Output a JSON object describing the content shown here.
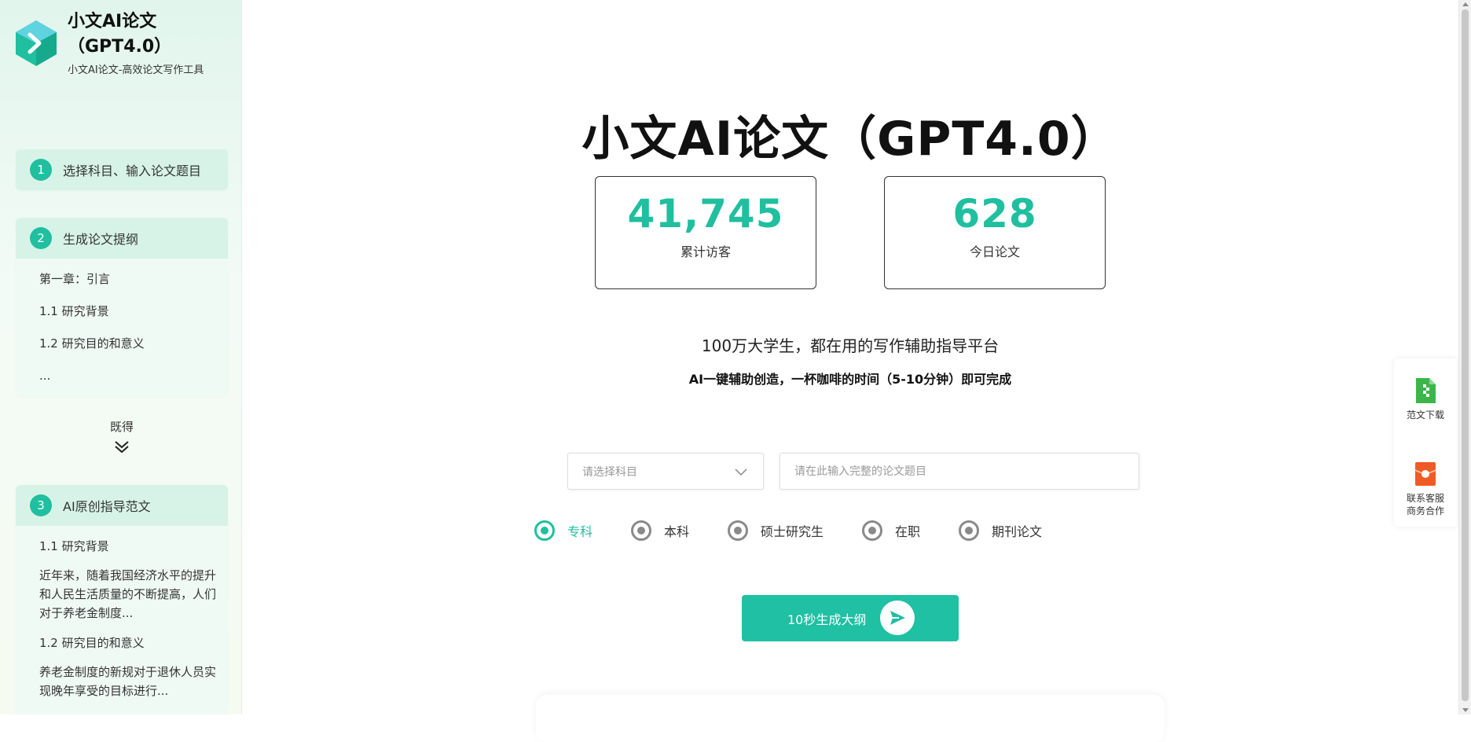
{
  "brand": {
    "title": "小文AI论文（GPT4.0）",
    "subtitle": "小文AI论文-高效论文写作工具",
    "colors": {
      "logo_primary": "#1fbf9f",
      "logo_secondary": "#6fd6e6"
    }
  },
  "sidebar": {
    "steps": [
      {
        "num": "1",
        "label": "选择科目、输入论文题目"
      },
      {
        "num": "2",
        "label": "生成论文提纲",
        "lines": [
          "第一章：引言",
          "1.1 研究背景",
          "1.2 研究目的和意义",
          "..."
        ]
      },
      {
        "num": "3",
        "label": "AI原创指导范文",
        "lines": [
          "1.1 研究背景",
          "近年来，随着我国经济水平的提升和人民生活质量的不断提高，人们对于养老金制度...",
          "1.2 研究目的和意义",
          "养老金制度的新规对于退休人员实现晚年享受的目标进行..."
        ]
      }
    ],
    "expand_label": "既得"
  },
  "hero": {
    "title": "小文AI论文（GPT4.0）",
    "stats": [
      {
        "value": "41,745",
        "label": "累计访客"
      },
      {
        "value": "628",
        "label": "今日论文"
      }
    ],
    "tagline": "100万大学生，都在用的写作辅助指导平台",
    "tagline_sub": "AI一键辅助创造，一杯咖啡的时间（5-10分钟）即可完成"
  },
  "form": {
    "subject_placeholder": "请选择科目",
    "title_placeholder": "请在此输入完整的论文题目",
    "levels": [
      {
        "label": "专科",
        "selected": true
      },
      {
        "label": "本科",
        "selected": false
      },
      {
        "label": "硕士研究生",
        "selected": false
      },
      {
        "label": "在职",
        "selected": false
      },
      {
        "label": "期刊论文",
        "selected": false
      }
    ],
    "generate_label": "10秒生成大纲"
  },
  "float_panel": {
    "download_label": "范文下载",
    "contact_line1": "联系客服",
    "contact_line2": "商务合作"
  },
  "colors": {
    "accent": "#1fbf9f",
    "sidebar_header": "#d7f3e8",
    "download_icon": "#3cb64a",
    "contact_icon": "#f05a24"
  }
}
